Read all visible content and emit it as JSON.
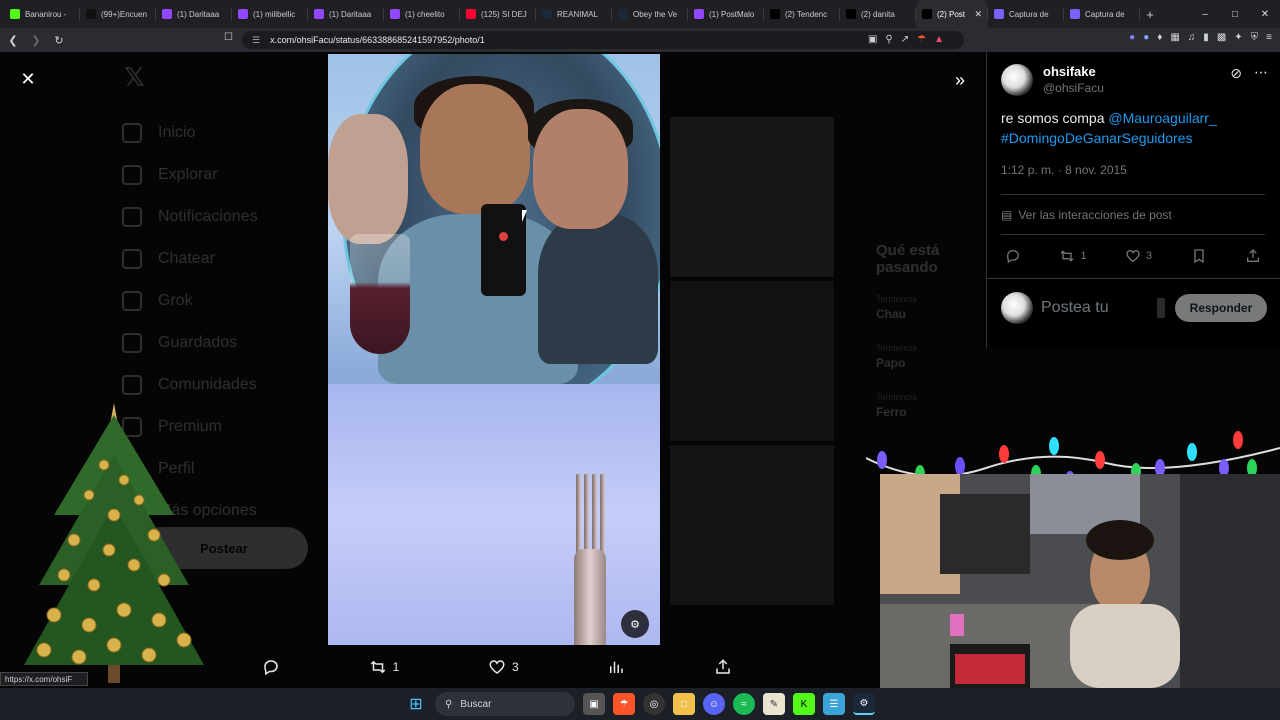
{
  "browser": {
    "tabs": [
      {
        "label": "Bananirou -",
        "icon": "kick-icon",
        "color": "#53fc18"
      },
      {
        "label": "(99+)Encuen",
        "icon": "tiktok-icon",
        "color": "#111111"
      },
      {
        "label": "(1) Daritaaa",
        "icon": "twitch-icon",
        "color": "#9146ff"
      },
      {
        "label": "(1) milibellic",
        "icon": "twitch-icon",
        "color": "#9146ff"
      },
      {
        "label": "(1) Daritaaa",
        "icon": "twitch-icon",
        "color": "#9146ff"
      },
      {
        "label": "(1) cheelito",
        "icon": "twitch-icon",
        "color": "#9146ff"
      },
      {
        "label": "(125) SI DEJ",
        "icon": "youtube-icon",
        "color": "#ff0033"
      },
      {
        "label": "REANIMAL",
        "icon": "steam-icon",
        "color": "#1b2838"
      },
      {
        "label": "Obey the Ve",
        "icon": "steam-icon",
        "color": "#1b2838"
      },
      {
        "label": "(1) PostMalo",
        "icon": "twitch-icon",
        "color": "#9146ff"
      },
      {
        "label": "(2) Tendenc",
        "icon": "x-icon",
        "color": "#000000"
      },
      {
        "label": "(2) danita",
        "icon": "x-icon",
        "color": "#000000"
      },
      {
        "label": "(2) Post",
        "icon": "x-icon",
        "color": "#000000",
        "active": true
      },
      {
        "label": "Captura de",
        "icon": "feather-icon",
        "color": "#7b61ff"
      },
      {
        "label": "Captura de",
        "icon": "feather-icon",
        "color": "#7b61ff"
      }
    ],
    "url": "x.com/ohsiFacu/status/663388685241597952/photo/1",
    "status_url": "https://x.com/ohsiF"
  },
  "background": {
    "nav": [
      "Inicio",
      "Explorar",
      "Notificaciones",
      "Chatear",
      "Grok",
      "Guardados",
      "Comunidades",
      "Premium",
      "Perfil",
      "Más opciones"
    ],
    "post_button": "Postear",
    "trends_title": "Qué está pasando",
    "trends": [
      {
        "meta": "Tendencia",
        "name": "Chau"
      },
      {
        "meta": "Tendencia",
        "name": "Papo"
      },
      {
        "meta": "Tendencia",
        "name": "Ferro"
      }
    ]
  },
  "media_actions": {
    "retweets": "1",
    "likes": "3"
  },
  "tweet": {
    "display_name": "ohsifake",
    "handle": "@ohsiFacu",
    "text_plain": "re somos compa ",
    "mention": "@Mauroaguilarr_",
    "hashtag": "#DomingoDeGanarSeguidores",
    "timestamp": "1:12 p. m. · 8 nov. 2015",
    "analytics_label": "Ver las interacciones de post",
    "retweets": "1",
    "likes": "3",
    "reply_placeholder": "Postea tu",
    "reply_button": "Responder"
  },
  "taskbar": {
    "search_label": "Buscar"
  },
  "colors": {
    "accent": "#1d9bf0",
    "panel_bg": "#000000",
    "muted": "#71767b"
  }
}
